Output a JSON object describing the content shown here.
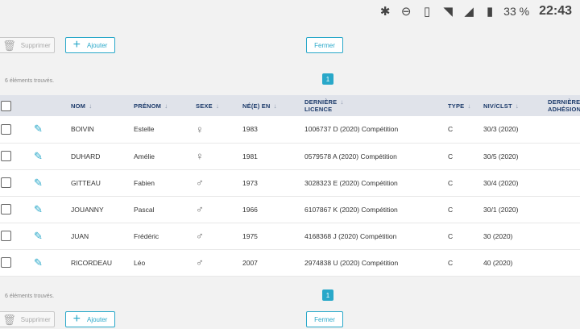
{
  "statusbar": {
    "icons": [
      "bluetooth-icon",
      "do-not-disturb-icon",
      "vibrate-icon",
      "wifi-icon",
      "cell-signal-icon",
      "battery-icon"
    ],
    "battery": "33 %",
    "time": "22:43"
  },
  "toolbar": {
    "delete_label": "Supprimer",
    "add_label": "Ajouter",
    "close_label": "Fermer"
  },
  "results": {
    "count_text": "6 éléments trouvés."
  },
  "pagination": {
    "current_page": "1"
  },
  "table": {
    "columns": {
      "nom": "NOM",
      "prenom": "PRÉNOM",
      "sexe": "SEXE",
      "ne_en": "NÉ(E) EN",
      "licence_l1": "DERNIÈRE",
      "licence_l2": "LICENCE",
      "type": "TYPE",
      "niv": "NIV/CLST",
      "adhesion_l1": "DERNIÈRE",
      "adhesion_l2": "ADHÉSION"
    },
    "rows": [
      {
        "nom": "BOIVIN",
        "prenom": "Estelle",
        "sexe": "♀",
        "annee": "1983",
        "licence": "1006737 D (2020) Compétition",
        "type": "C",
        "niv": "30/3 (2020)"
      },
      {
        "nom": "DUHARD",
        "prenom": "Amélie",
        "sexe": "♀",
        "annee": "1981",
        "licence": "0579578 A (2020) Compétition",
        "type": "C",
        "niv": "30/5 (2020)"
      },
      {
        "nom": "GITTEAU",
        "prenom": "Fabien",
        "sexe": "♂",
        "annee": "1973",
        "licence": "3028323 E (2020) Compétition",
        "type": "C",
        "niv": "30/4 (2020)"
      },
      {
        "nom": "JOUANNY",
        "prenom": "Pascal",
        "sexe": "♂",
        "annee": "1966",
        "licence": "6107867 K (2020) Compétition",
        "type": "C",
        "niv": "30/1 (2020)"
      },
      {
        "nom": "JUAN",
        "prenom": "Frédéric",
        "sexe": "♂",
        "annee": "1975",
        "licence": "4168368 J (2020) Compétition",
        "type": "C",
        "niv": "30 (2020)"
      },
      {
        "nom": "RICORDEAU",
        "prenom": "Léo",
        "sexe": "♂",
        "annee": "2007",
        "licence": "2974838 U (2020) Compétition",
        "type": "C",
        "niv": "40 (2020)"
      }
    ]
  },
  "colors": {
    "accent": "#29a8c9",
    "header_bg": "#e0e3ea",
    "header_text": "#1d3b6b"
  }
}
